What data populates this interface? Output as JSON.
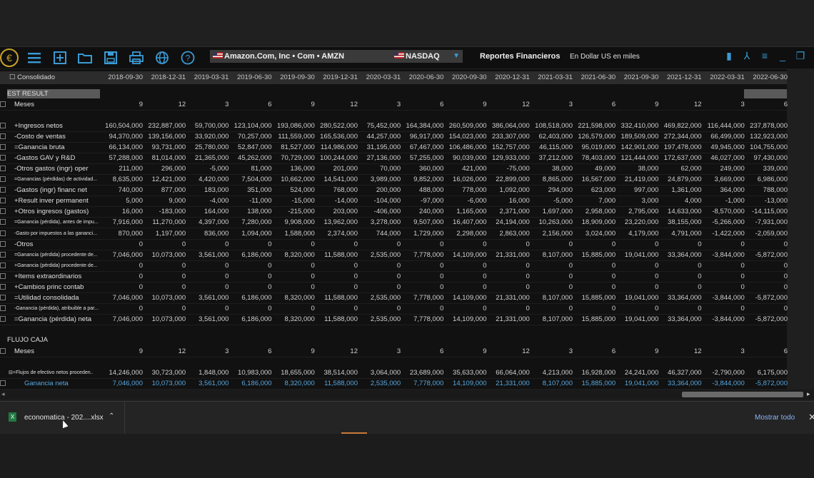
{
  "toolbar": {
    "logo": "€",
    "icons": [
      "menu-icon",
      "add-icon",
      "folder-icon",
      "save-icon",
      "print-icon",
      "globe-icon",
      "help-icon"
    ],
    "company": "Amazon.Com, Inc • Com • AMZN",
    "exchange": "NASDAQ",
    "report_title": "Reportes Financieros",
    "currency": "En Dollar US en miles"
  },
  "grid": {
    "header_label": "Consolidado",
    "dates": [
      "2018-09-30",
      "2018-12-31",
      "2019-03-31",
      "2019-06-30",
      "2019-09-30",
      "2019-12-31",
      "2020-03-31",
      "2020-06-30",
      "2020-09-30",
      "2020-12-31",
      "2021-03-31",
      "2021-06-30",
      "2021-09-30",
      "2021-12-31",
      "2022-03-31",
      "2022-06-30"
    ],
    "section1": "EST RESULT",
    "section2": "FLUJO CAJA",
    "meses_label": "Meses",
    "meses": [
      "9",
      "12",
      "3",
      "6",
      "9",
      "12",
      "3",
      "6",
      "9",
      "12",
      "3",
      "6",
      "9",
      "12",
      "3",
      "6"
    ],
    "rows": [
      {
        "label": "+Ingresos netos",
        "small": false,
        "values": [
          "160,504,000",
          "232,887,000",
          "59,700,000",
          "123,104,000",
          "193,086,000",
          "280,522,000",
          "75,452,000",
          "164,384,000",
          "260,509,000",
          "386,064,000",
          "108,518,000",
          "221,598,000",
          "332,410,000",
          "469,822,000",
          "116,444,000",
          "237,878,000"
        ]
      },
      {
        "label": "-Costo de ventas",
        "small": false,
        "values": [
          "94,370,000",
          "139,156,000",
          "33,920,000",
          "70,257,000",
          "111,559,000",
          "165,536,000",
          "44,257,000",
          "96,917,000",
          "154,023,000",
          "233,307,000",
          "62,403,000",
          "126,579,000",
          "189,509,000",
          "272,344,000",
          "66,499,000",
          "132,923,000"
        ]
      },
      {
        "label": "=Ganancia bruta",
        "small": false,
        "values": [
          "66,134,000",
          "93,731,000",
          "25,780,000",
          "52,847,000",
          "81,527,000",
          "114,986,000",
          "31,195,000",
          "67,467,000",
          "106,486,000",
          "152,757,000",
          "46,115,000",
          "95,019,000",
          "142,901,000",
          "197,478,000",
          "49,945,000",
          "104,755,000"
        ]
      },
      {
        "label": "-Gastos GAV y R&D",
        "small": false,
        "values": [
          "57,288,000",
          "81,014,000",
          "21,365,000",
          "45,262,000",
          "70,729,000",
          "100,244,000",
          "27,136,000",
          "57,255,000",
          "90,039,000",
          "129,933,000",
          "37,212,000",
          "78,403,000",
          "121,444,000",
          "172,637,000",
          "46,027,000",
          "97,430,000"
        ]
      },
      {
        "label": "-Otros gastos (ingr) oper",
        "small": false,
        "values": [
          "211,000",
          "296,000",
          "-5,000",
          "81,000",
          "136,000",
          "201,000",
          "70,000",
          "360,000",
          "421,000",
          "-75,000",
          "38,000",
          "49,000",
          "38,000",
          "62,000",
          "249,000",
          "339,000"
        ]
      },
      {
        "label": "=Ganancias (pérdidas) de actividad...",
        "small": true,
        "values": [
          "8,635,000",
          "12,421,000",
          "4,420,000",
          "7,504,000",
          "10,662,000",
          "14,541,000",
          "3,989,000",
          "9,852,000",
          "16,026,000",
          "22,899,000",
          "8,865,000",
          "16,567,000",
          "21,419,000",
          "24,879,000",
          "3,669,000",
          "6,986,000"
        ]
      },
      {
        "label": "-Gastos (ingr) financ net",
        "small": false,
        "values": [
          "740,000",
          "877,000",
          "183,000",
          "351,000",
          "524,000",
          "768,000",
          "200,000",
          "488,000",
          "778,000",
          "1,092,000",
          "294,000",
          "623,000",
          "997,000",
          "1,361,000",
          "364,000",
          "788,000"
        ]
      },
      {
        "label": "+Result inver permanent",
        "small": false,
        "values": [
          "5,000",
          "9,000",
          "-4,000",
          "-11,000",
          "-15,000",
          "-14,000",
          "-104,000",
          "-97,000",
          "-6,000",
          "16,000",
          "-5,000",
          "7,000",
          "3,000",
          "4,000",
          "-1,000",
          "-13,000"
        ]
      },
      {
        "label": "+Otros ingresos (gastos)",
        "small": false,
        "values": [
          "16,000",
          "-183,000",
          "164,000",
          "138,000",
          "-215,000",
          "203,000",
          "-406,000",
          "240,000",
          "1,165,000",
          "2,371,000",
          "1,697,000",
          "2,958,000",
          "2,795,000",
          "14,633,000",
          "-8,570,000",
          "-14,115,000"
        ]
      },
      {
        "label": "=Ganancia (pérdida), antes de impu...",
        "small": true,
        "values": [
          "7,916,000",
          "11,270,000",
          "4,397,000",
          "7,280,000",
          "9,908,000",
          "13,962,000",
          "3,278,000",
          "9,507,000",
          "16,407,000",
          "24,194,000",
          "10,263,000",
          "18,909,000",
          "23,220,000",
          "38,155,000",
          "-5,266,000",
          "-7,931,000"
        ]
      },
      {
        "label": "-Gasto por impuestos a las gananci...",
        "small": true,
        "values": [
          "870,000",
          "1,197,000",
          "836,000",
          "1,094,000",
          "1,588,000",
          "2,374,000",
          "744,000",
          "1,729,000",
          "2,298,000",
          "2,863,000",
          "2,156,000",
          "3,024,000",
          "4,179,000",
          "4,791,000",
          "-1,422,000",
          "-2,059,000"
        ]
      },
      {
        "label": "-Otros",
        "small": false,
        "values": [
          "0",
          "0",
          "0",
          "0",
          "0",
          "0",
          "0",
          "0",
          "0",
          "0",
          "0",
          "0",
          "0",
          "0",
          "0",
          "0"
        ]
      },
      {
        "label": "=Ganancia (pérdida) procedente de...",
        "small": true,
        "values": [
          "7,046,000",
          "10,073,000",
          "3,561,000",
          "6,186,000",
          "8,320,000",
          "11,588,000",
          "2,535,000",
          "7,778,000",
          "14,109,000",
          "21,331,000",
          "8,107,000",
          "15,885,000",
          "19,041,000",
          "33,364,000",
          "-3,844,000",
          "-5,872,000"
        ]
      },
      {
        "label": "+Ganancia (pérdida) procedente de...",
        "small": true,
        "values": [
          "0",
          "0",
          "0",
          "0",
          "0",
          "0",
          "0",
          "0",
          "0",
          "0",
          "0",
          "0",
          "0",
          "0",
          "0",
          "0"
        ]
      },
      {
        "label": "+Items extraordinarios",
        "small": false,
        "values": [
          "0",
          "0",
          "0",
          "0",
          "0",
          "0",
          "0",
          "0",
          "0",
          "0",
          "0",
          "0",
          "0",
          "0",
          "0",
          "0"
        ]
      },
      {
        "label": "+Cambios princ contab",
        "small": false,
        "values": [
          "0",
          "0",
          "0",
          "0",
          "0",
          "0",
          "0",
          "0",
          "0",
          "0",
          "0",
          "0",
          "0",
          "0",
          "0",
          "0"
        ]
      },
      {
        "label": "=Utilidad consolidada",
        "small": false,
        "values": [
          "7,046,000",
          "10,073,000",
          "3,561,000",
          "6,186,000",
          "8,320,000",
          "11,588,000",
          "2,535,000",
          "7,778,000",
          "14,109,000",
          "21,331,000",
          "8,107,000",
          "15,885,000",
          "19,041,000",
          "33,364,000",
          "-3,844,000",
          "-5,872,000"
        ]
      },
      {
        "label": "-Ganancia (pérdida), atribuible a par...",
        "small": true,
        "values": [
          "0",
          "0",
          "0",
          "0",
          "0",
          "0",
          "0",
          "0",
          "0",
          "0",
          "0",
          "0",
          "0",
          "0",
          "0",
          "0"
        ]
      },
      {
        "label": "=Ganancia (pérdida) neta",
        "small": false,
        "values": [
          "7,046,000",
          "10,073,000",
          "3,561,000",
          "6,186,000",
          "8,320,000",
          "11,588,000",
          "2,535,000",
          "7,778,000",
          "14,109,000",
          "21,331,000",
          "8,107,000",
          "15,885,000",
          "19,041,000",
          "33,364,000",
          "-3,844,000",
          "-5,872,000"
        ]
      }
    ],
    "cash_rows": [
      {
        "label": "⊟+Flujos de efectivo netos proceden...",
        "small": true,
        "blue": false,
        "values": [
          "14,246,000",
          "30,723,000",
          "1,848,000",
          "10,983,000",
          "18,655,000",
          "38,514,000",
          "3,064,000",
          "23,689,000",
          "35,633,000",
          "66,064,000",
          "4,213,000",
          "16,928,000",
          "24,241,000",
          "46,327,000",
          "-2,790,000",
          "6,175,000"
        ]
      },
      {
        "label": "Ganancia neta",
        "small": false,
        "blue": true,
        "values": [
          "7,046,000",
          "10,073,000",
          "3,561,000",
          "6,186,000",
          "8,320,000",
          "11,588,000",
          "2,535,000",
          "7,778,000",
          "14,109,000",
          "21,331,000",
          "8,107,000",
          "15,885,000",
          "19,041,000",
          "33,364,000",
          "-3,844,000",
          "-5,872,000"
        ]
      }
    ]
  },
  "download_bar": {
    "file_name": "economatica - 202....xlsx",
    "show_all": "Mostrar todo",
    "close": "✕"
  },
  "colors": {
    "accent": "#3a9bd6",
    "link": "#8ab4f8",
    "excel": "#1f7a43"
  }
}
